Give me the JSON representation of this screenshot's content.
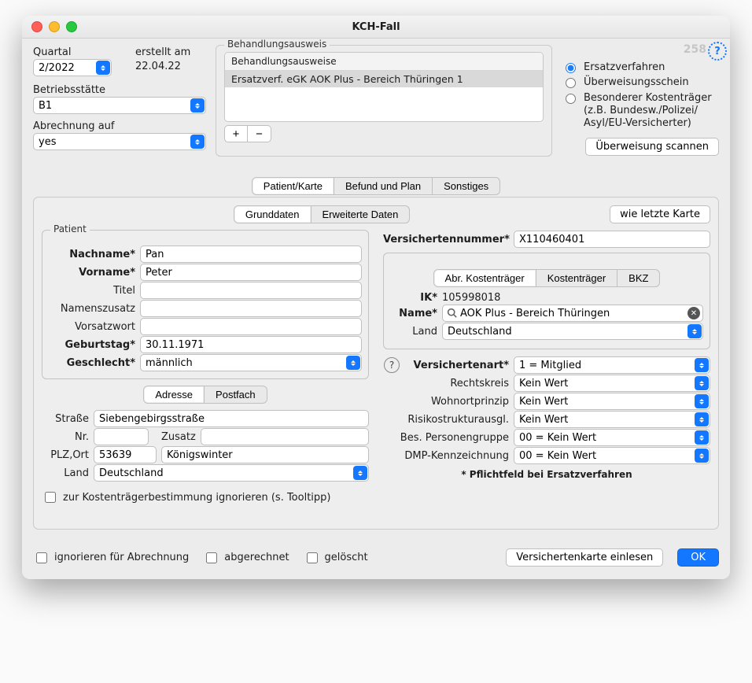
{
  "window": {
    "title": "KCH-Fall",
    "counter": "258"
  },
  "top_left": {
    "quartal_label": "Quartal",
    "quartal_value": "2/2022",
    "erstellt_label": "erstellt am",
    "erstellt_value": "22.04.22",
    "betriebsstaette_label": "Betriebsstätte",
    "betriebsstaette_value": "B1",
    "abrechnung_label": "Abrechnung auf",
    "abrechnung_value": "yes"
  },
  "listbox": {
    "legend": "Behandlungsausweis",
    "header": "Behandlungsausweise",
    "row1": "Ersatzverf. eGK AOK Plus - Bereich Thüringen 1",
    "add": "+",
    "remove": "−"
  },
  "radios": {
    "r1": "Ersatzverfahren",
    "r2": "Überweisungsschein",
    "r3a": "Besonderer Kostenträger",
    "r3b": "(z.B. Bundesw./Polizei/",
    "r3c": "Asyl/EU-Versicherter)"
  },
  "buttons": {
    "scan": "Überweisung scannen",
    "wie_letzte": "wie letzte Karte",
    "einlesen": "Versichertenkarte einlesen",
    "ok": "OK"
  },
  "main_tabs": {
    "t1": "Patient/Karte",
    "t2": "Befund und Plan",
    "t3": "Sonstiges"
  },
  "sub_tabs": {
    "t1": "Grunddaten",
    "t2": "Erweiterte Daten"
  },
  "patient": {
    "legend": "Patient",
    "nachname_l": "Nachname*",
    "nachname_v": "Pan",
    "vorname_l": "Vorname*",
    "vorname_v": "Peter",
    "titel_l": "Titel",
    "titel_v": "",
    "namenszusatz_l": "Namenszusatz",
    "namenszusatz_v": "",
    "vorsatzwort_l": "Vorsatzwort",
    "vorsatzwort_v": "",
    "geburtstag_l": "Geburtstag*",
    "geburtstag_v": "30.11.1971",
    "geschlecht_l": "Geschlecht*",
    "geschlecht_v": "männlich"
  },
  "addr_tabs": {
    "t1": "Adresse",
    "t2": "Postfach"
  },
  "address": {
    "strasse_l": "Straße",
    "strasse_v": "Siebengebirgsstraße",
    "nr_l": "Nr.",
    "nr_v": "",
    "zusatz_l": "Zusatz",
    "zusatz_v": "",
    "plzort_l": "PLZ,Ort",
    "plz_v": "53639",
    "ort_v": "Königswinter",
    "land_l": "Land",
    "land_v": "Deutschland"
  },
  "kost_ignore": "zur Kostenträgerbestimmung ignorieren (s. Tooltipp)",
  "right": {
    "versnr_l": "Versichertennummer*",
    "versnr_v": "X110460401"
  },
  "ik_tabs": {
    "t1": "Abr. Kostenträger",
    "t2": "Kostenträger",
    "t3": "BKZ"
  },
  "ik": {
    "ik_l": "IK*",
    "ik_v": "105998018",
    "name_l": "Name*",
    "name_v": "AOK Plus - Bereich Thüringen",
    "land_l": "Land",
    "land_v": "Deutschland"
  },
  "insure": {
    "versart_l": "Versichertenart*",
    "versart_v": "1 = Mitglied",
    "rechtskreis_l": "Rechtskreis",
    "rechtskreis_v": "Kein Wert",
    "wohnort_l": "Wohnortprinzip",
    "wohnort_v": "Kein Wert",
    "risiko_l": "Risikostrukturausgl.",
    "risiko_v": "Kein Wert",
    "pers_l": "Bes. Personengruppe",
    "pers_v": "00 = Kein Wert",
    "dmp_l": "DMP-Kennzeichnung",
    "dmp_v": "00 = Kein Wert",
    "pflicht": "* Pflichtfeld bei Ersatzverfahren"
  },
  "footer_checks": {
    "c1": "ignorieren für Abrechnung",
    "c2": "abgerechnet",
    "c3": "gelöscht"
  }
}
